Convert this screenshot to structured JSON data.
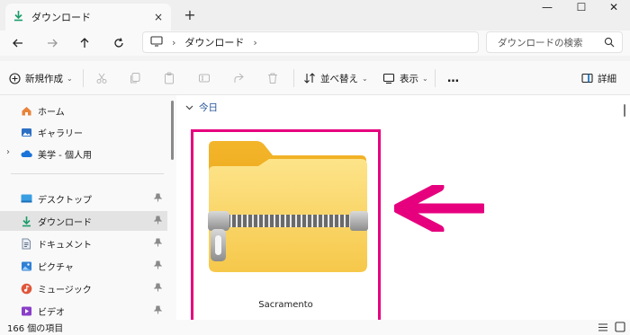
{
  "tab": {
    "title": "ダウンロード",
    "close": "×",
    "new_tab": "+"
  },
  "window": {
    "minimize": "—",
    "maximize": "☐",
    "close": "✕"
  },
  "nav": {
    "breadcrumb": [
      "ダウンロード"
    ],
    "search_placeholder": "ダウンロードの検索"
  },
  "toolbar": {
    "new_label": "新規作成",
    "sort_label": "並べ替え",
    "view_label": "表示",
    "more_label": "…",
    "details_label": "詳細"
  },
  "sidebar": {
    "items": [
      {
        "label": "ホーム",
        "icon": "home-icon"
      },
      {
        "label": "ギャラリー",
        "icon": "gallery-icon"
      },
      {
        "label": "美学 - 個人用",
        "icon": "onedrive-icon"
      },
      {
        "label": "デスクトップ",
        "icon": "desktop-icon"
      },
      {
        "label": "ダウンロード",
        "icon": "download-icon"
      },
      {
        "label": "ドキュメント",
        "icon": "documents-icon"
      },
      {
        "label": "ピクチャ",
        "icon": "pictures-icon"
      },
      {
        "label": "ミュージック",
        "icon": "music-icon"
      },
      {
        "label": "ビデオ",
        "icon": "videos-icon"
      }
    ]
  },
  "main": {
    "group_label": "今日",
    "file": {
      "name": "Sacramento",
      "type": "compressed-folder"
    },
    "highlight_color": "#e6007e",
    "arrow_color": "#e6007e"
  },
  "status": {
    "item_count": "166 個の項目"
  },
  "colors": {
    "accent": "#0067c0",
    "folder": "#f7c948"
  }
}
